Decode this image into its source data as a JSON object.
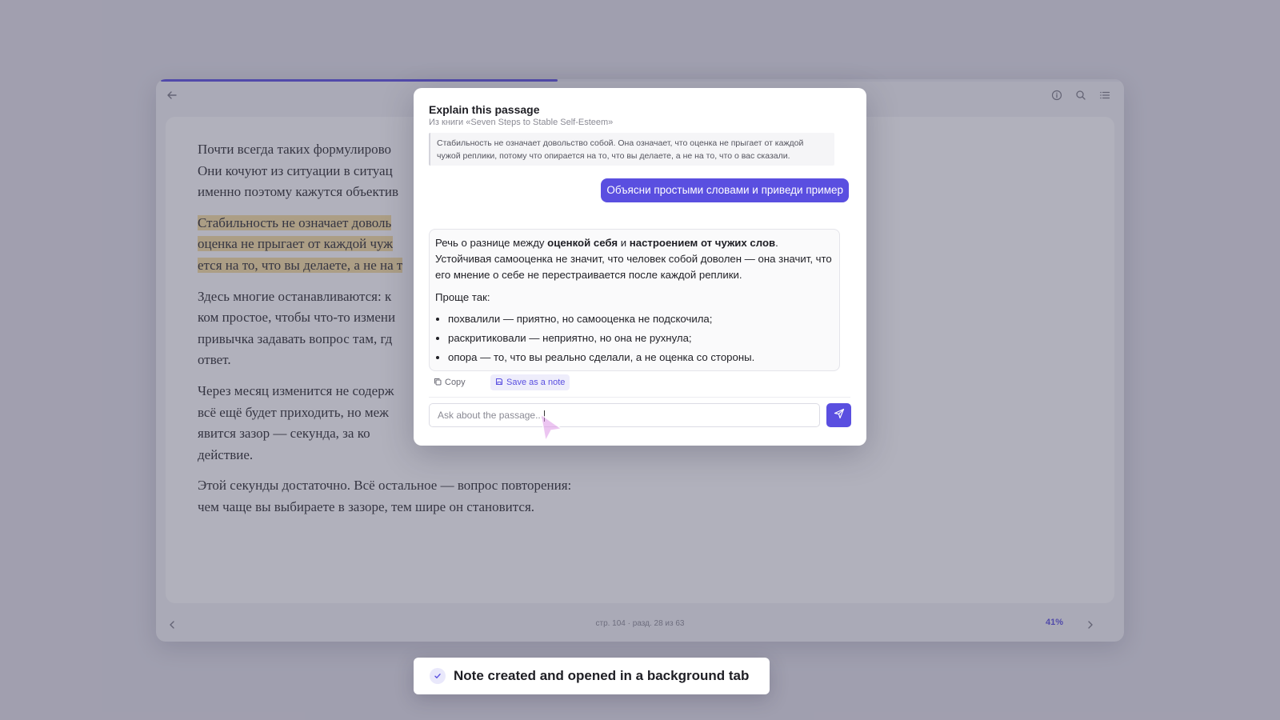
{
  "reader": {
    "progress_pct": 41,
    "paragraphs": [
      {
        "text": "Почти всегда таких формулирово",
        "highlight": false
      },
      {
        "text": "Они кочуют из ситуации в ситуац",
        "highlight": false
      },
      {
        "text": "именно поэтому кажутся объектив",
        "highlight": false
      }
    ],
    "p1": [
      "Почти всегда таких формулирово",
      "Они кочуют из ситуации в ситуац",
      "именно поэтому кажутся объектив"
    ],
    "p2": [
      "Стабильность не означает доволь",
      "оценка не прыгает от каждой чуж",
      "ется на то, что вы делаете, а не на т"
    ],
    "p3": [
      "Здесь многие останавливаются: к",
      "ком простое, чтобы что-то измени",
      "привычка задавать вопрос там, гд",
      "ответ."
    ],
    "p4": [
      "Через месяц изменится не содерж",
      "всё ещё будет приходить, но меж",
      "явится зазор — секунда, за ко",
      "действие."
    ],
    "p5": [
      "Этой секунды достаточно. Всё остальное — вопрос повторения:",
      "чем чаще вы выбираете в зазоре, тем шире он становится."
    ],
    "page_info": "стр. 104 · разд. 28 из 63",
    "percent_label": "41%"
  },
  "dialog": {
    "title": "Explain this passage",
    "subtitle": "Из книги «Seven Steps to Stable Self-Esteem»",
    "quote": "Стабильность не означает довольство собой. Она означает, что оценка не прыгает от каждой чужой реплики, потому что опирается на то, что вы делаете, а не на то, что о вас сказали.",
    "user_message": "Объясни простыми словами и приведи пример",
    "answer": {
      "intro_a": "Речь о разнице между ",
      "intro_bold1": "оценкой себя",
      "intro_b": " и ",
      "intro_bold2": "настроением от чужих слов",
      "intro_c": ".",
      "intro_rest": "Устойчивая самооценка не значит, что человек собой доволен — она значит, что его мнение о себе не перестраивается после каждой реплики.",
      "lead": "Проще так:",
      "bullets": [
        "похвалили — приятно, но самооценка не подскочила;",
        "раскритиковали — неприятно, но она не рухнула;",
        "опора — то, что вы реально сделали, а не оценка со стороны."
      ]
    },
    "copy_label": "Copy",
    "save_label": "Save as a note",
    "input_placeholder": "Ask about the passage..."
  },
  "toast": {
    "message": "Note created and opened in a background tab"
  },
  "colors": {
    "accent": "#5a4fe0",
    "highlight": "#f6dea1"
  }
}
